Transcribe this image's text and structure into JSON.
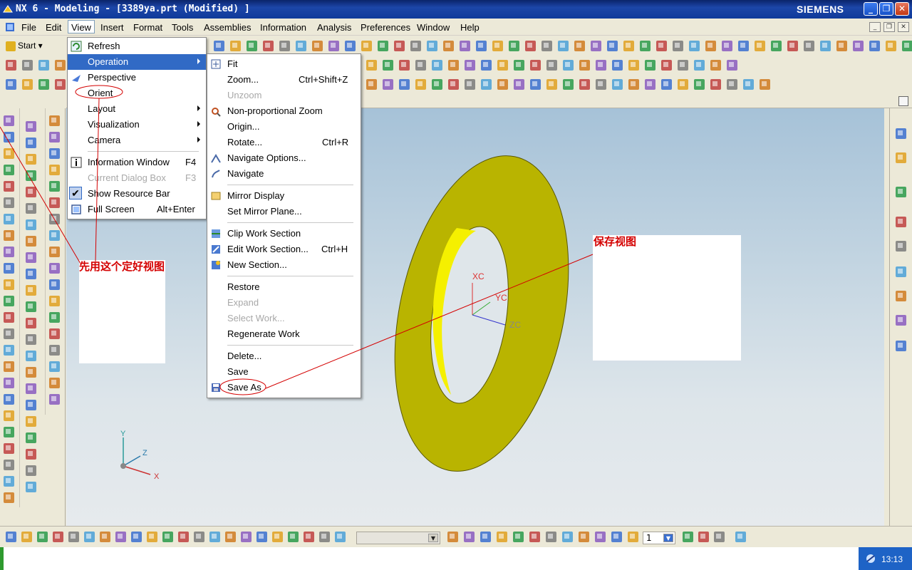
{
  "window": {
    "title": "NX 6 - Modeling - [3389ya.prt (Modified) ]",
    "brand": "SIEMENS",
    "minimize": "_",
    "maximize": "❐",
    "close": "✕"
  },
  "menubar": {
    "items": [
      "File",
      "Edit",
      "View",
      "Insert",
      "Format",
      "Tools",
      "Assemblies",
      "Information",
      "Analysis",
      "Preferences",
      "Window",
      "Help"
    ],
    "active": "View"
  },
  "toolbar": {
    "start_label": "Start"
  },
  "view_menu": {
    "items": [
      {
        "label": "Refresh"
      },
      {
        "label": "Operation"
      },
      {
        "label": "Perspective"
      },
      {
        "label": "Orient"
      },
      {
        "label": "Layout"
      },
      {
        "label": "Visualization"
      },
      {
        "label": "Camera"
      },
      {
        "label": "Information Window",
        "shortcut": "F4"
      },
      {
        "label": "Current Dialog Box",
        "shortcut": "F3"
      },
      {
        "label": "Show Resource Bar"
      },
      {
        "label": "Full Screen",
        "shortcut": "Alt+Enter"
      }
    ]
  },
  "operation_menu": {
    "items": [
      {
        "label": "Fit"
      },
      {
        "label": "Zoom...",
        "shortcut": "Ctrl+Shift+Z"
      },
      {
        "label": "Unzoom"
      },
      {
        "label": "Non-proportional Zoom"
      },
      {
        "label": "Origin..."
      },
      {
        "label": "Rotate...",
        "shortcut": "Ctrl+R"
      },
      {
        "label": "Navigate Options..."
      },
      {
        "label": "Navigate"
      },
      {
        "label": "Mirror Display"
      },
      {
        "label": "Set Mirror Plane..."
      },
      {
        "label": "Clip Work Section"
      },
      {
        "label": "Edit Work Section...",
        "shortcut": "Ctrl+H"
      },
      {
        "label": "New Section..."
      },
      {
        "label": "Restore"
      },
      {
        "label": "Expand"
      },
      {
        "label": "Select Work..."
      },
      {
        "label": "Regenerate Work"
      },
      {
        "label": "Delete..."
      },
      {
        "label": "Save"
      },
      {
        "label": "Save As"
      }
    ]
  },
  "annotations": {
    "left_note": "先用这个定好视图",
    "right_note": "保存视图",
    "color": "#d40000"
  },
  "viewport": {
    "wcs_labels": {
      "xc": "XC",
      "yc": "YC",
      "zc": "ZC"
    },
    "triad_labels": {
      "x": "X",
      "y": "Y",
      "z": "Z"
    },
    "part_color": "#b5b300"
  },
  "bottom": {
    "layer_value": "1"
  },
  "taskbar": {
    "clock": "13:13"
  }
}
